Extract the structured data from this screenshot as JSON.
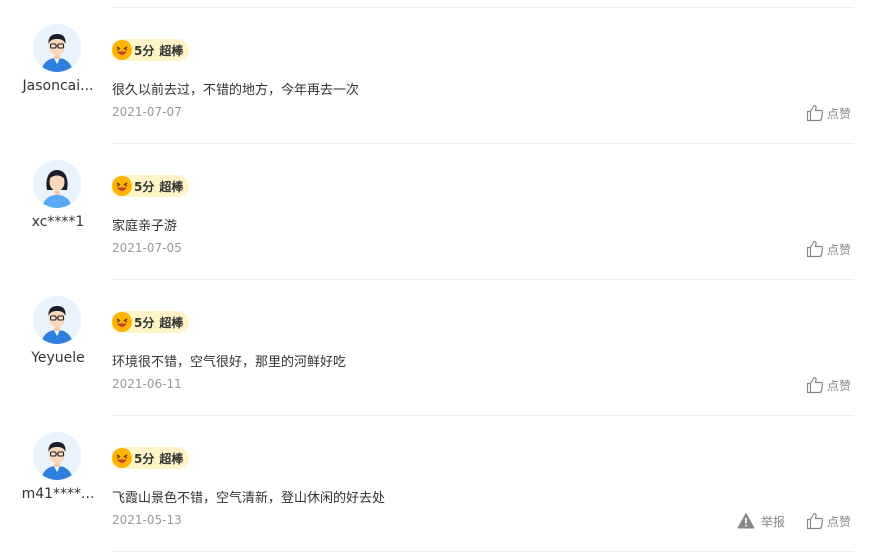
{
  "reviews": [
    {
      "username": "Jasoncai...",
      "avatar": "male-avatar",
      "score": "5分",
      "level": "超棒",
      "content": "很久以前去过，不错的地方，今年再去一次",
      "date": "2021-07-07",
      "like_label": "点赞"
    },
    {
      "username": "xc****1",
      "avatar": "female-avatar",
      "score": "5分",
      "level": "超棒",
      "content": "家庭亲子游",
      "date": "2021-07-05",
      "like_label": "点赞"
    },
    {
      "username": "Yeyuele",
      "avatar": "male-avatar",
      "score": "5分",
      "level": "超棒",
      "content": "环境很不错，空气很好，那里的河鲜好吃",
      "date": "2021-06-11",
      "like_label": "点赞"
    },
    {
      "username": "m41****...",
      "avatar": "male-avatar",
      "score": "5分",
      "level": "超棒",
      "content": "飞霞山景色不错，空气清新，登山休闲的好去处",
      "date": "2021-05-13",
      "like_label": "点赞",
      "report_label": "举报"
    }
  ],
  "colors": {
    "rating_bg": "#fff4c8",
    "divider": "#eeeeee",
    "muted_text": "#999999",
    "avatar_blue": "#2f7fe0"
  }
}
